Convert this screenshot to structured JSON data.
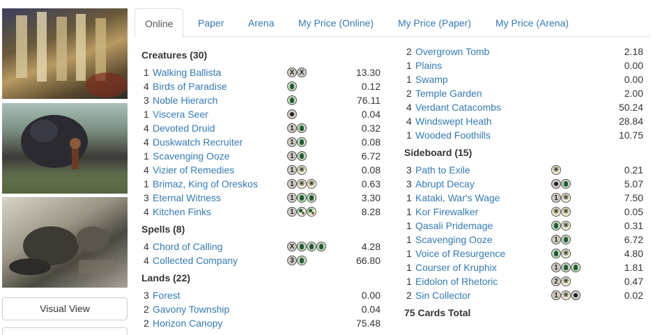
{
  "sidebar": {
    "visual_view_label": "Visual View",
    "second_button_label": ""
  },
  "tabs": [
    {
      "label": "Online",
      "active": true
    },
    {
      "label": "Paper",
      "active": false
    },
    {
      "label": "Arena",
      "active": false
    },
    {
      "label": "My Price (Online)",
      "active": false
    },
    {
      "label": "My Price (Paper)",
      "active": false
    },
    {
      "label": "My Price (Arena)",
      "active": false
    }
  ],
  "deck": {
    "creatures_heading": "Creatures (30)",
    "creatures": [
      {
        "qty": "1",
        "name": "Walking Ballista",
        "cost": [
          "X",
          "X"
        ],
        "price": "13.30"
      },
      {
        "qty": "4",
        "name": "Birds of Paradise",
        "cost": [
          "G"
        ],
        "price": "0.12"
      },
      {
        "qty": "3",
        "name": "Noble Hierarch",
        "cost": [
          "G"
        ],
        "price": "76.11"
      },
      {
        "qty": "1",
        "name": "Viscera Seer",
        "cost": [
          "B"
        ],
        "price": "0.04"
      },
      {
        "qty": "4",
        "name": "Devoted Druid",
        "cost": [
          "1",
          "G"
        ],
        "price": "0.32"
      },
      {
        "qty": "4",
        "name": "Duskwatch Recruiter",
        "cost": [
          "1",
          "G"
        ],
        "price": "0.08"
      },
      {
        "qty": "1",
        "name": "Scavenging Ooze",
        "cost": [
          "1",
          "G"
        ],
        "price": "6.72"
      },
      {
        "qty": "4",
        "name": "Vizier of Remedies",
        "cost": [
          "1",
          "W"
        ],
        "price": "0.08"
      },
      {
        "qty": "1",
        "name": "Brimaz, King of Oreskos",
        "cost": [
          "1",
          "W",
          "W"
        ],
        "price": "0.63"
      },
      {
        "qty": "3",
        "name": "Eternal Witness",
        "cost": [
          "1",
          "G",
          "G"
        ],
        "price": "3.30"
      },
      {
        "qty": "4",
        "name": "Kitchen Finks",
        "cost": [
          "1",
          "GW",
          "GW"
        ],
        "price": "8.28"
      }
    ],
    "spells_heading": "Spells (8)",
    "spells": [
      {
        "qty": "4",
        "name": "Chord of Calling",
        "cost": [
          "X",
          "G",
          "G",
          "G"
        ],
        "price": "4.28"
      },
      {
        "qty": "4",
        "name": "Collected Company",
        "cost": [
          "3",
          "G"
        ],
        "price": "66.80"
      }
    ],
    "lands_heading": "Lands (22)",
    "lands_left": [
      {
        "qty": "3",
        "name": "Forest",
        "cost": [],
        "price": "0.00"
      },
      {
        "qty": "2",
        "name": "Gavony Township",
        "cost": [],
        "price": "0.04"
      },
      {
        "qty": "2",
        "name": "Horizon Canopy",
        "cost": [],
        "price": "75.48"
      }
    ],
    "lands_right": [
      {
        "qty": "2",
        "name": "Overgrown Tomb",
        "cost": [],
        "price": "2.18"
      },
      {
        "qty": "1",
        "name": "Plains",
        "cost": [],
        "price": "0.00"
      },
      {
        "qty": "1",
        "name": "Swamp",
        "cost": [],
        "price": "0.00"
      },
      {
        "qty": "2",
        "name": "Temple Garden",
        "cost": [],
        "price": "2.00"
      },
      {
        "qty": "4",
        "name": "Verdant Catacombs",
        "cost": [],
        "price": "50.24"
      },
      {
        "qty": "4",
        "name": "Windswept Heath",
        "cost": [],
        "price": "28.84"
      },
      {
        "qty": "1",
        "name": "Wooded Foothills",
        "cost": [],
        "price": "10.75"
      }
    ],
    "sideboard_heading": "Sideboard (15)",
    "sideboard": [
      {
        "qty": "3",
        "name": "Path to Exile",
        "cost": [
          "W"
        ],
        "price": "0.21"
      },
      {
        "qty": "3",
        "name": "Abrupt Decay",
        "cost": [
          "B",
          "G"
        ],
        "price": "5.07"
      },
      {
        "qty": "1",
        "name": "Kataki, War's Wage",
        "cost": [
          "1",
          "W"
        ],
        "price": "7.50"
      },
      {
        "qty": "1",
        "name": "Kor Firewalker",
        "cost": [
          "W",
          "W"
        ],
        "price": "0.05"
      },
      {
        "qty": "1",
        "name": "Qasali Pridemage",
        "cost": [
          "G",
          "W"
        ],
        "price": "0.31"
      },
      {
        "qty": "1",
        "name": "Scavenging Ooze",
        "cost": [
          "1",
          "G"
        ],
        "price": "6.72"
      },
      {
        "qty": "1",
        "name": "Voice of Resurgence",
        "cost": [
          "G",
          "W"
        ],
        "price": "4.80"
      },
      {
        "qty": "1",
        "name": "Courser of Kruphix",
        "cost": [
          "1",
          "G",
          "G"
        ],
        "price": "1.81"
      },
      {
        "qty": "1",
        "name": "Eidolon of Rhetoric",
        "cost": [
          "2",
          "W"
        ],
        "price": "0.47"
      },
      {
        "qty": "2",
        "name": "Sin Collector",
        "cost": [
          "1",
          "W",
          "B"
        ],
        "price": "0.02"
      }
    ],
    "total_label": "75 Cards Total"
  }
}
